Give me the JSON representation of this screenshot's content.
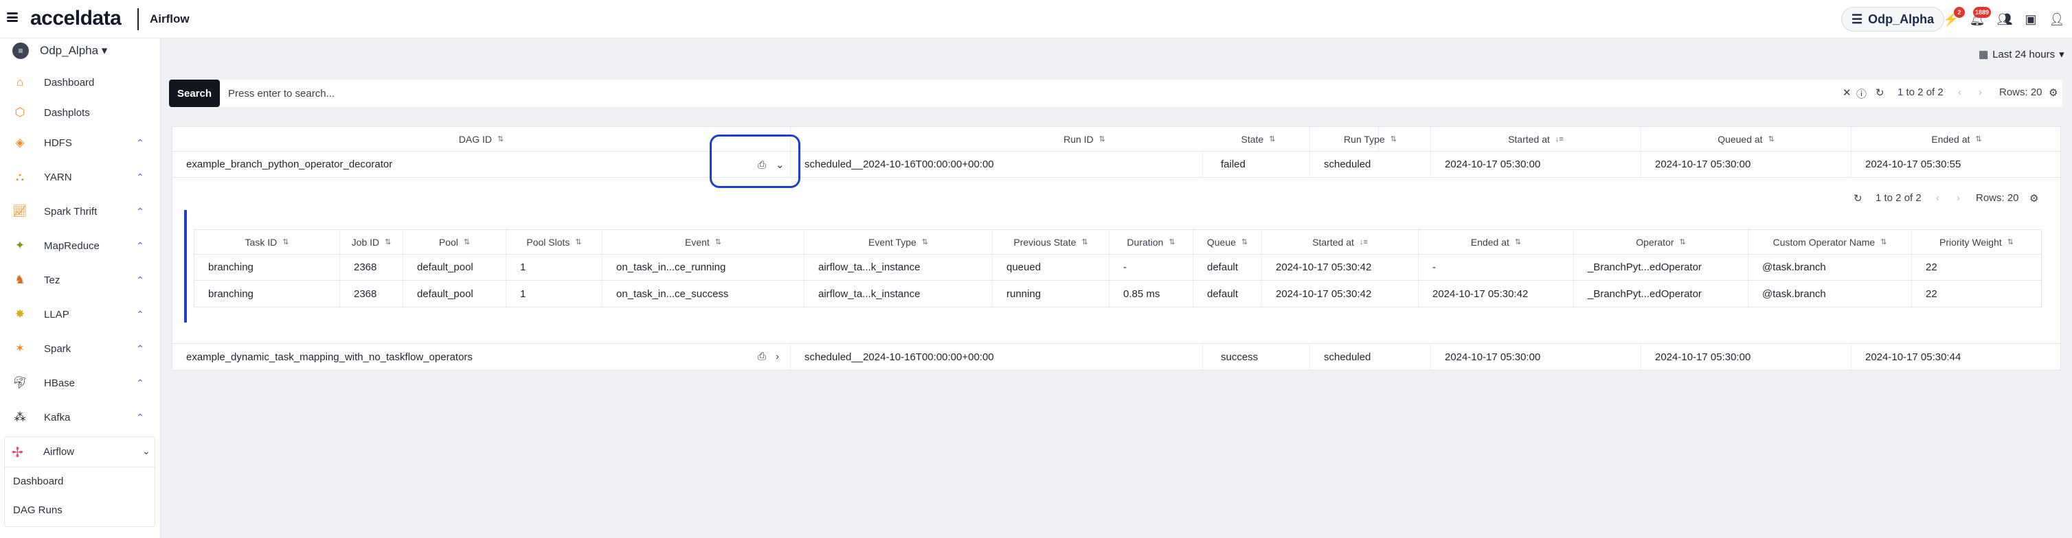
{
  "topbar": {
    "brand": "acceldata",
    "app_name": "Airflow",
    "cluster": "Odp_Alpha",
    "alert_count": "2",
    "notif_count": "1889"
  },
  "sidebar": {
    "cluster_name": "Odp_Alpha ▾",
    "items": [
      {
        "label": "Dashboard",
        "icon": "home-icon",
        "color": "#f08a1c"
      },
      {
        "label": "Dashplots",
        "icon": "cube-icon",
        "color": "#f08a1c"
      },
      {
        "label": "HDFS",
        "icon": "layers-icon",
        "color": "#f08a1c"
      },
      {
        "label": "YARN",
        "icon": "hierarchy-icon",
        "color": "#f08a1c"
      },
      {
        "label": "Spark Thrift",
        "icon": "chart-icon",
        "color": "#f08a1c"
      },
      {
        "label": "MapReduce",
        "icon": "mapreduce-icon",
        "color": "#7a9a1c"
      },
      {
        "label": "Tez",
        "icon": "tez-icon",
        "color": "#d66a1c"
      },
      {
        "label": "LLAP",
        "icon": "llap-icon",
        "color": "#d6b01c"
      },
      {
        "label": "Spark",
        "icon": "spark-icon",
        "color": "#f08a1c"
      },
      {
        "label": "HBase",
        "icon": "hbase-icon",
        "color": "#1b1f2a"
      },
      {
        "label": "Kafka",
        "icon": "kafka-icon",
        "color": "#1b1f2a"
      }
    ],
    "airflow": {
      "label": "Airflow",
      "sub_items": [
        "Dashboard",
        "DAG Runs"
      ]
    }
  },
  "toolbar": {
    "time_range": "Last 24 hours",
    "search_button": "Search",
    "search_placeholder": "Press enter to search...",
    "pagination": "1 to 2 of 2",
    "rows": "Rows: 20"
  },
  "dag_table": {
    "headers": [
      "DAG ID",
      "Run ID",
      "State",
      "Run Type",
      "Started at",
      "Queued at",
      "Ended at"
    ],
    "rows": [
      {
        "dag_id": "example_branch_python_operator_decorator",
        "run_id": "scheduled__2024-10-16T00:00:00+00:00",
        "state": "failed",
        "run_type": "scheduled",
        "started_at": "2024-10-17 05:30:00",
        "queued_at": "2024-10-17 05:30:00",
        "ended_at": "2024-10-17 05:30:55"
      },
      {
        "dag_id": "example_dynamic_task_mapping_with_no_taskflow_operators",
        "run_id": "scheduled__2024-10-16T00:00:00+00:00",
        "state": "success",
        "run_type": "scheduled",
        "started_at": "2024-10-17 05:30:00",
        "queued_at": "2024-10-17 05:30:00",
        "ended_at": "2024-10-17 05:30:44"
      }
    ]
  },
  "task_table": {
    "pagination": "1 to 2 of 2",
    "rows_label": "Rows: 20",
    "headers": [
      "Task ID",
      "Job ID",
      "Pool",
      "Pool Slots",
      "Event",
      "Event Type",
      "Previous State",
      "Duration",
      "Queue",
      "Started at",
      "Ended at",
      "Operator",
      "Custom Operator Name",
      "Priority Weight"
    ],
    "rows": [
      [
        "branching",
        "2368",
        "default_pool",
        "1",
        "on_task_in...ce_running",
        "airflow_ta...k_instance",
        "queued",
        "-",
        "default",
        "2024-10-17 05:30:42",
        "-",
        "_BranchPyt...edOperator",
        "@task.branch",
        "22"
      ],
      [
        "branching",
        "2368",
        "default_pool",
        "1",
        "on_task_in...ce_success",
        "airflow_ta...k_instance",
        "running",
        "0.85 ms",
        "default",
        "2024-10-17 05:30:42",
        "2024-10-17 05:30:42",
        "_BranchPyt...edOperator",
        "@task.branch",
        "22"
      ]
    ]
  }
}
